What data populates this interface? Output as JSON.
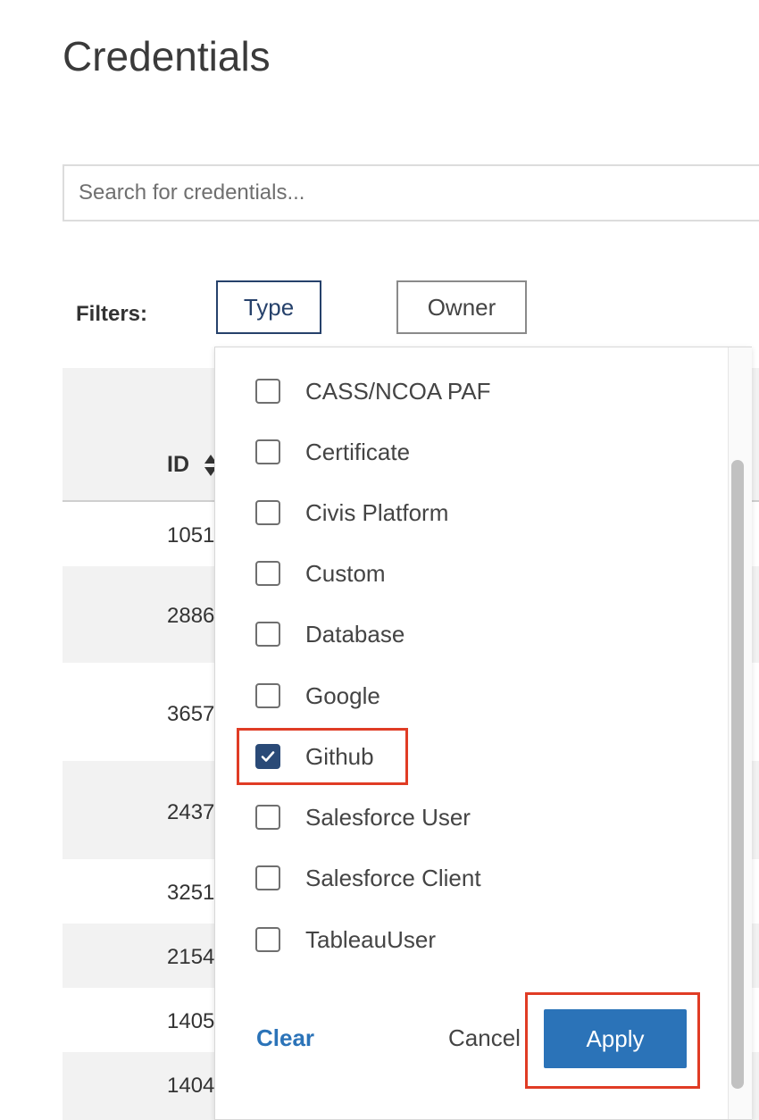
{
  "page": {
    "title": "Credentials"
  },
  "search": {
    "placeholder": "Search for credentials..."
  },
  "filters": {
    "label": "Filters:",
    "type_label": "Type",
    "owner_label": "Owner"
  },
  "table": {
    "id_header": "ID",
    "rows": [
      "1051",
      "2886",
      "3657",
      "2437",
      "3251",
      "2154",
      "1405",
      "1404"
    ]
  },
  "type_dropdown": {
    "options": [
      {
        "label": "CASS/NCOA PAF",
        "checked": false
      },
      {
        "label": "Certificate",
        "checked": false
      },
      {
        "label": "Civis Platform",
        "checked": false
      },
      {
        "label": "Custom",
        "checked": false
      },
      {
        "label": "Database",
        "checked": false
      },
      {
        "label": "Google",
        "checked": false
      },
      {
        "label": "Github",
        "checked": true
      },
      {
        "label": "Salesforce User",
        "checked": false
      },
      {
        "label": "Salesforce Client",
        "checked": false
      },
      {
        "label": "TableauUser",
        "checked": false
      }
    ],
    "clear_label": "Clear",
    "cancel_label": "Cancel",
    "apply_label": "Apply"
  },
  "colors": {
    "accent": "#2b73b8",
    "checkbox_checked": "#2a4a77",
    "highlight": "#e03c25"
  }
}
